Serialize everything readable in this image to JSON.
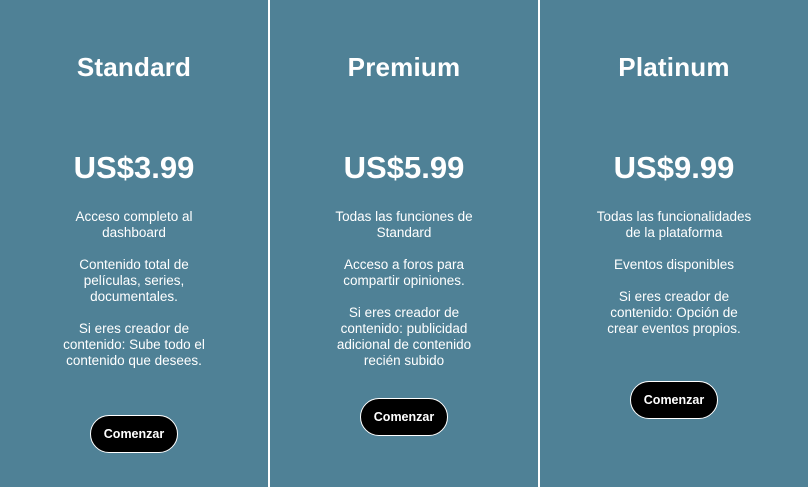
{
  "colors": {
    "card_background": "#4f8196",
    "divider": "#ffffff",
    "button_background": "#000000",
    "text": "#ffffff"
  },
  "plans": [
    {
      "name": "Standard",
      "price": "US$3.99",
      "features": [
        "Acceso completo al dashboard",
        "Contenido total de películas, series, documentales.",
        "Si eres creador de contenido: Sube todo el contenido que desees."
      ],
      "button_label": "Comenzar"
    },
    {
      "name": "Premium",
      "price": "US$5.99",
      "features": [
        "Todas las funciones de Standard",
        "Acceso a foros para compartir opiniones.",
        "Si eres creador de contenido: publicidad adicional de contenido recién subido"
      ],
      "button_label": "Comenzar"
    },
    {
      "name": "Platinum",
      "price": "US$9.99",
      "features": [
        "Todas las funcionalidades de la plataforma",
        "Eventos disponibles",
        "Si eres creador de contenido: Opción de crear eventos propios."
      ],
      "button_label": "Comenzar"
    }
  ]
}
